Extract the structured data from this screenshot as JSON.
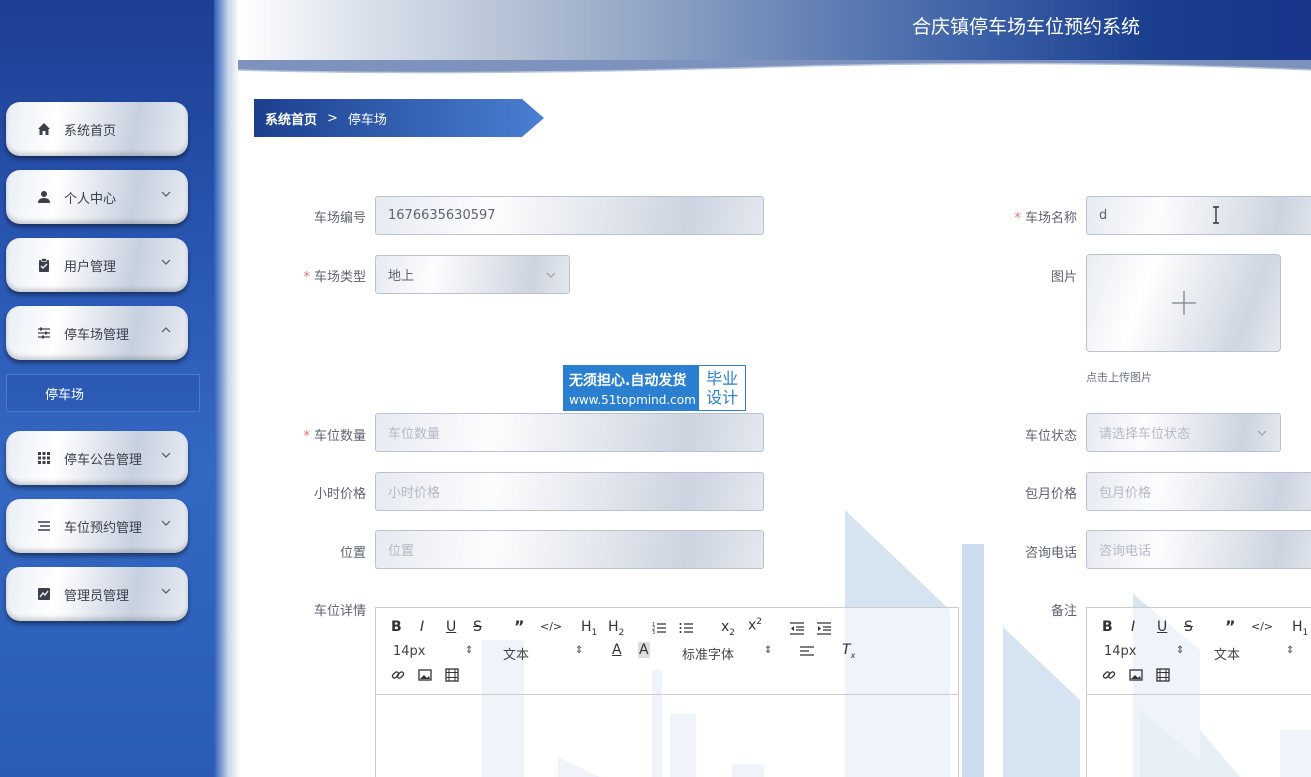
{
  "app": {
    "title": "合庆镇停车场车位预约系统"
  },
  "sidebar": {
    "items": [
      {
        "label": "系统首页",
        "icon": "home-icon"
      },
      {
        "label": "个人中心",
        "icon": "user-icon"
      },
      {
        "label": "用户管理",
        "icon": "clipboard-icon"
      },
      {
        "label": "停车场管理",
        "icon": "sliders-icon"
      },
      {
        "label": "停车公告管理",
        "icon": "grid-icon"
      },
      {
        "label": "车位预约管理",
        "icon": "list-icon"
      },
      {
        "label": "管理员管理",
        "icon": "chart-icon"
      }
    ],
    "sub_items": [
      {
        "label": "停车场"
      }
    ]
  },
  "breadcrumb": {
    "home": "系统首页",
    "separator": ">",
    "current": "停车场"
  },
  "form": {
    "lot_id": {
      "label": "车场编号",
      "value": "1676635630597"
    },
    "lot_name": {
      "label": "车场名称",
      "value": "d"
    },
    "lot_type": {
      "label": "车场类型",
      "value": "地上"
    },
    "image": {
      "label": "图片",
      "hint": "点击上传图片"
    },
    "spot_count": {
      "label": "车位数量",
      "placeholder": "车位数量"
    },
    "spot_status": {
      "label": "车位状态",
      "placeholder": "请选择车位状态"
    },
    "hourly_price": {
      "label": "小时价格",
      "placeholder": "小时价格"
    },
    "monthly_price": {
      "label": "包月价格",
      "placeholder": "包月价格"
    },
    "location": {
      "label": "位置",
      "placeholder": "位置"
    },
    "phone": {
      "label": "咨询电话",
      "placeholder": "咨询电话"
    },
    "details": {
      "label": "车位详情"
    },
    "remarks": {
      "label": "备注"
    }
  },
  "editor": {
    "font_size": "14px",
    "heading_select": "文本",
    "font_family": "标准字体"
  },
  "watermark": {
    "line1": "无须担心.自动发货",
    "line2": "www.51topmind.com",
    "side1": "毕业",
    "side2": "设计"
  },
  "colors": {
    "accent": "#1e4c9e",
    "required": "#f56c6c"
  }
}
